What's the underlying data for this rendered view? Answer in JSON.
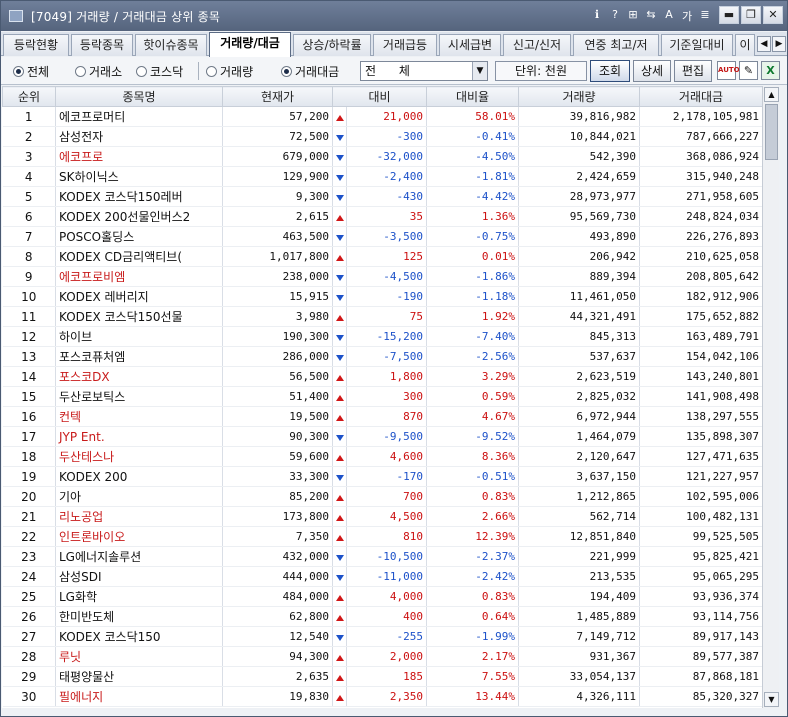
{
  "window": {
    "title": "[7049] 거래량 / 거래대금 상위 종목",
    "tools": [
      "ℹ",
      "?",
      "⊞",
      "⇆",
      "A",
      "가",
      "≣"
    ],
    "minimize": "▬",
    "restore": "❐",
    "close": "✕"
  },
  "tabs": [
    {
      "label": "등락현황",
      "active": false
    },
    {
      "label": "등락종목",
      "active": false
    },
    {
      "label": "핫이슈종목",
      "active": false
    },
    {
      "label": "거래량/대금",
      "active": true
    },
    {
      "label": "상승/하락률",
      "active": false
    },
    {
      "label": "거래급등",
      "active": false
    },
    {
      "label": "시세급변",
      "active": false
    },
    {
      "label": "신고/신저",
      "active": false
    },
    {
      "label": "연중 최고/저",
      "active": false
    },
    {
      "label": "기준일대비",
      "active": false
    },
    {
      "label": "이",
      "active": false
    }
  ],
  "tab_nav": {
    "prev": "◀",
    "next": "▶"
  },
  "filters": {
    "market": [
      {
        "label": "전체",
        "selected": true
      },
      {
        "label": "거래소",
        "selected": false
      },
      {
        "label": "코스닥",
        "selected": false
      }
    ],
    "sort": [
      {
        "label": "거래량",
        "selected": false
      },
      {
        "label": "거래대금",
        "selected": true
      }
    ],
    "category_value": "전      체",
    "unit": "단위: 천원",
    "buttons": {
      "query": "조회",
      "detail": "상세",
      "edit": "편집"
    },
    "icons": {
      "auto": "AUTO",
      "memo": "✎",
      "excel": "X"
    }
  },
  "table": {
    "headers": [
      "순위",
      "종목명",
      "현재가",
      "대비",
      "대비율",
      "거래량",
      "거래대금"
    ],
    "rows": [
      {
        "rank": "1",
        "name": "에코프로머티",
        "name_color": "normal",
        "price": "57,200",
        "dir": "up",
        "change": "21,000",
        "rate": "58.01%",
        "volume": "39,816,982",
        "amount": "2,178,105,981"
      },
      {
        "rank": "2",
        "name": "삼성전자",
        "name_color": "normal",
        "price": "72,500",
        "dir": "down",
        "change": "-300",
        "rate": "-0.41%",
        "volume": "10,844,021",
        "amount": "787,666,227"
      },
      {
        "rank": "3",
        "name": "에코프로",
        "name_color": "red",
        "price": "679,000",
        "dir": "down",
        "change": "-32,000",
        "rate": "-4.50%",
        "volume": "542,390",
        "amount": "368,086,924"
      },
      {
        "rank": "4",
        "name": "SK하이닉스",
        "name_color": "normal",
        "price": "129,900",
        "dir": "down",
        "change": "-2,400",
        "rate": "-1.81%",
        "volume": "2,424,659",
        "amount": "315,940,248"
      },
      {
        "rank": "5",
        "name": "KODEX 코스닥150레버",
        "name_color": "normal",
        "price": "9,300",
        "dir": "down",
        "change": "-430",
        "rate": "-4.42%",
        "volume": "28,973,977",
        "amount": "271,958,605"
      },
      {
        "rank": "6",
        "name": "KODEX 200선물인버스2",
        "name_color": "normal",
        "price": "2,615",
        "dir": "up",
        "change": "35",
        "rate": "1.36%",
        "volume": "95,569,730",
        "amount": "248,824,034"
      },
      {
        "rank": "7",
        "name": "POSCO홀딩스",
        "name_color": "normal",
        "price": "463,500",
        "dir": "down",
        "change": "-3,500",
        "rate": "-0.75%",
        "volume": "493,890",
        "amount": "226,276,893"
      },
      {
        "rank": "8",
        "name": "KODEX CD금리액티브(",
        "name_color": "normal",
        "price": "1,017,800",
        "dir": "up",
        "change": "125",
        "rate": "0.01%",
        "volume": "206,942",
        "amount": "210,625,058"
      },
      {
        "rank": "9",
        "name": "에코프로비엠",
        "name_color": "red",
        "price": "238,000",
        "dir": "down",
        "change": "-4,500",
        "rate": "-1.86%",
        "volume": "889,394",
        "amount": "208,805,642"
      },
      {
        "rank": "10",
        "name": "KODEX 레버리지",
        "name_color": "normal",
        "price": "15,915",
        "dir": "down",
        "change": "-190",
        "rate": "-1.18%",
        "volume": "11,461,050",
        "amount": "182,912,906"
      },
      {
        "rank": "11",
        "name": "KODEX 코스닥150선물",
        "name_color": "normal",
        "price": "3,980",
        "dir": "up",
        "change": "75",
        "rate": "1.92%",
        "volume": "44,321,491",
        "amount": "175,652,882"
      },
      {
        "rank": "12",
        "name": "하이브",
        "name_color": "normal",
        "price": "190,300",
        "dir": "down",
        "change": "-15,200",
        "rate": "-7.40%",
        "volume": "845,313",
        "amount": "163,489,791"
      },
      {
        "rank": "13",
        "name": "포스코퓨처엠",
        "name_color": "normal",
        "price": "286,000",
        "dir": "down",
        "change": "-7,500",
        "rate": "-2.56%",
        "volume": "537,637",
        "amount": "154,042,106"
      },
      {
        "rank": "14",
        "name": "포스코DX",
        "name_color": "red",
        "price": "56,500",
        "dir": "up",
        "change": "1,800",
        "rate": "3.29%",
        "volume": "2,623,519",
        "amount": "143,240,801"
      },
      {
        "rank": "15",
        "name": "두산로보틱스",
        "name_color": "normal",
        "price": "51,400",
        "dir": "up",
        "change": "300",
        "rate": "0.59%",
        "volume": "2,825,032",
        "amount": "141,908,498"
      },
      {
        "rank": "16",
        "name": "컨텍",
        "name_color": "red",
        "price": "19,500",
        "dir": "up",
        "change": "870",
        "rate": "4.67%",
        "volume": "6,972,944",
        "amount": "138,297,555"
      },
      {
        "rank": "17",
        "name": "JYP Ent.",
        "name_color": "red",
        "price": "90,300",
        "dir": "down",
        "change": "-9,500",
        "rate": "-9.52%",
        "volume": "1,464,079",
        "amount": "135,898,307"
      },
      {
        "rank": "18",
        "name": "두산테스나",
        "name_color": "red",
        "price": "59,600",
        "dir": "up",
        "change": "4,600",
        "rate": "8.36%",
        "volume": "2,120,647",
        "amount": "127,471,635"
      },
      {
        "rank": "19",
        "name": "KODEX 200",
        "name_color": "normal",
        "price": "33,300",
        "dir": "down",
        "change": "-170",
        "rate": "-0.51%",
        "volume": "3,637,150",
        "amount": "121,227,957"
      },
      {
        "rank": "20",
        "name": "기아",
        "name_color": "normal",
        "price": "85,200",
        "dir": "up",
        "change": "700",
        "rate": "0.83%",
        "volume": "1,212,865",
        "amount": "102,595,006"
      },
      {
        "rank": "21",
        "name": "리노공업",
        "name_color": "red",
        "price": "173,800",
        "dir": "up",
        "change": "4,500",
        "rate": "2.66%",
        "volume": "562,714",
        "amount": "100,482,131"
      },
      {
        "rank": "22",
        "name": "인트론바이오",
        "name_color": "red",
        "price": "7,350",
        "dir": "up",
        "change": "810",
        "rate": "12.39%",
        "volume": "12,851,840",
        "amount": "99,525,505"
      },
      {
        "rank": "23",
        "name": "LG에너지솔루션",
        "name_color": "normal",
        "price": "432,000",
        "dir": "down",
        "change": "-10,500",
        "rate": "-2.37%",
        "volume": "221,999",
        "amount": "95,825,421"
      },
      {
        "rank": "24",
        "name": "삼성SDI",
        "name_color": "normal",
        "price": "444,000",
        "dir": "down",
        "change": "-11,000",
        "rate": "-2.42%",
        "volume": "213,535",
        "amount": "95,065,295"
      },
      {
        "rank": "25",
        "name": "LG화학",
        "name_color": "normal",
        "price": "484,000",
        "dir": "up",
        "change": "4,000",
        "rate": "0.83%",
        "volume": "194,409",
        "amount": "93,936,374"
      },
      {
        "rank": "26",
        "name": "한미반도체",
        "name_color": "normal",
        "price": "62,800",
        "dir": "up",
        "change": "400",
        "rate": "0.64%",
        "volume": "1,485,889",
        "amount": "93,114,756"
      },
      {
        "rank": "27",
        "name": "KODEX 코스닥150",
        "name_color": "normal",
        "price": "12,540",
        "dir": "down",
        "change": "-255",
        "rate": "-1.99%",
        "volume": "7,149,712",
        "amount": "89,917,143"
      },
      {
        "rank": "28",
        "name": "루닛",
        "name_color": "red",
        "price": "94,300",
        "dir": "up",
        "change": "2,000",
        "rate": "2.17%",
        "volume": "931,367",
        "amount": "89,577,387"
      },
      {
        "rank": "29",
        "name": "태평양물산",
        "name_color": "normal",
        "price": "2,635",
        "dir": "up",
        "change": "185",
        "rate": "7.55%",
        "volume": "33,054,137",
        "amount": "87,868,181"
      },
      {
        "rank": "30",
        "name": "필에너지",
        "name_color": "red",
        "price": "19,830",
        "dir": "up",
        "change": "2,350",
        "rate": "13.44%",
        "volume": "4,326,111",
        "amount": "85,320,327"
      }
    ]
  },
  "scrollbar": {
    "up": "▲",
    "down": "▼"
  },
  "colors": {
    "up": "#cc1111",
    "down": "#1d52c9",
    "title_bar": "#5f6f88",
    "active_tab": "#ffffff"
  }
}
